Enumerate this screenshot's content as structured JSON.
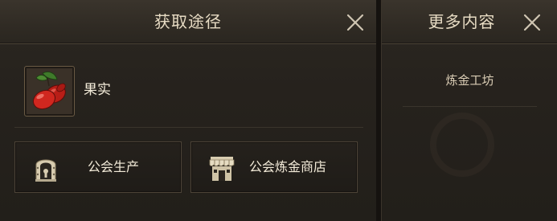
{
  "left_panel": {
    "title": "获取途径",
    "close_icon": "close-icon",
    "item": {
      "name": "果实",
      "icon": "red-fruit-icon"
    },
    "sources": [
      {
        "label": "公会生产",
        "icon": "guild-gate-icon"
      },
      {
        "label": "公会炼金商店",
        "icon": "shop-awning-icon"
      }
    ]
  },
  "right_panel": {
    "title": "更多内容",
    "close_icon": "close-icon",
    "items": [
      {
        "label": "炼金工坊"
      }
    ]
  },
  "colors": {
    "panel_bg": "#26221d",
    "header_bg": "#302b24",
    "text_primary": "#f2ead8",
    "text_title": "#e8dcc4",
    "border": "#4c4337",
    "fruit_red": "#c8231c",
    "leaf_green": "#3f7a2a"
  }
}
